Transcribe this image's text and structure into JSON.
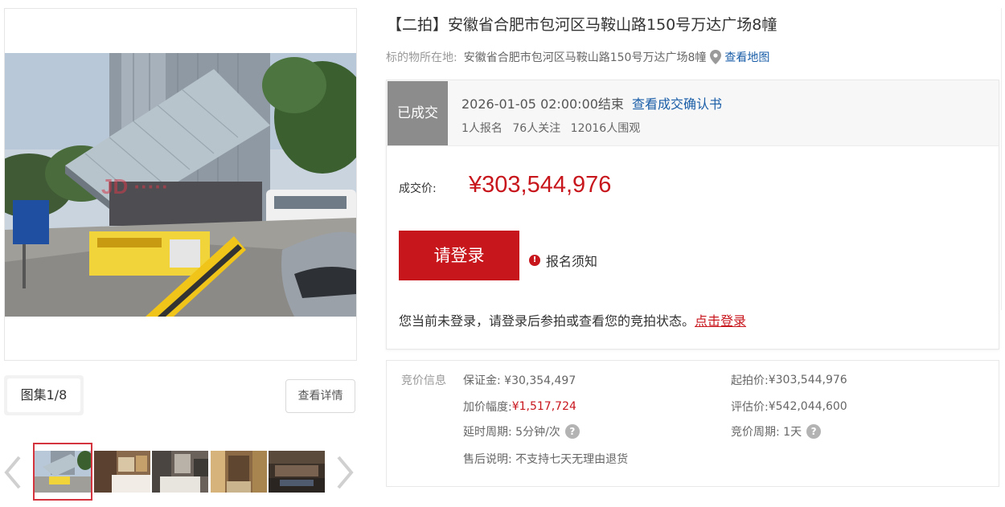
{
  "gallery": {
    "tab_label": "图集1/8",
    "detail_button": "查看详情"
  },
  "listing": {
    "title": "【二拍】安徽省合肥市包河区马鞍山路150号万达广场8幢",
    "location_label": "标的物所在地:",
    "location_value": "安徽省合肥市包河区马鞍山路150号万达广场8幢",
    "map_link": "查看地图"
  },
  "status": {
    "tag": "已成交",
    "end_time": "2026-01-05 02:00:00结束",
    "confirm_link": "查看成交确认书",
    "signups": "1人报名",
    "followers": "76人关注",
    "viewers": "12016人围观"
  },
  "deal": {
    "price_label": "成交价:",
    "price_value": "¥303,544,976"
  },
  "actions": {
    "login_button": "请登录",
    "notice_label": "报名须知",
    "login_tip": "您当前未登录，请登录后参拍或查看您的竞拍状态。",
    "login_link": "点击登录"
  },
  "bid_info": {
    "title": "竞价信息",
    "deposit": "保证金: ¥30,354,497",
    "start_price_label": "起拍价: ",
    "start_price": "¥303,544,976",
    "increment_label": "加价幅度: ",
    "increment": "¥1,517,724",
    "appraisal_label": "评估价: ",
    "appraisal": "¥542,044,600",
    "delay": "延时周期: 5分钟/次",
    "period": "竞价周期: 1天",
    "after_sale": "售后说明: 不支持七天无理由退货"
  },
  "colors": {
    "accent_red": "#c8161d",
    "link_blue": "#1a5ea8",
    "tag_gray": "#8c8c8c"
  },
  "icons": [
    "location-pin-icon",
    "alert-icon",
    "question-icon",
    "chevron-left-icon",
    "chevron-right-icon"
  ]
}
